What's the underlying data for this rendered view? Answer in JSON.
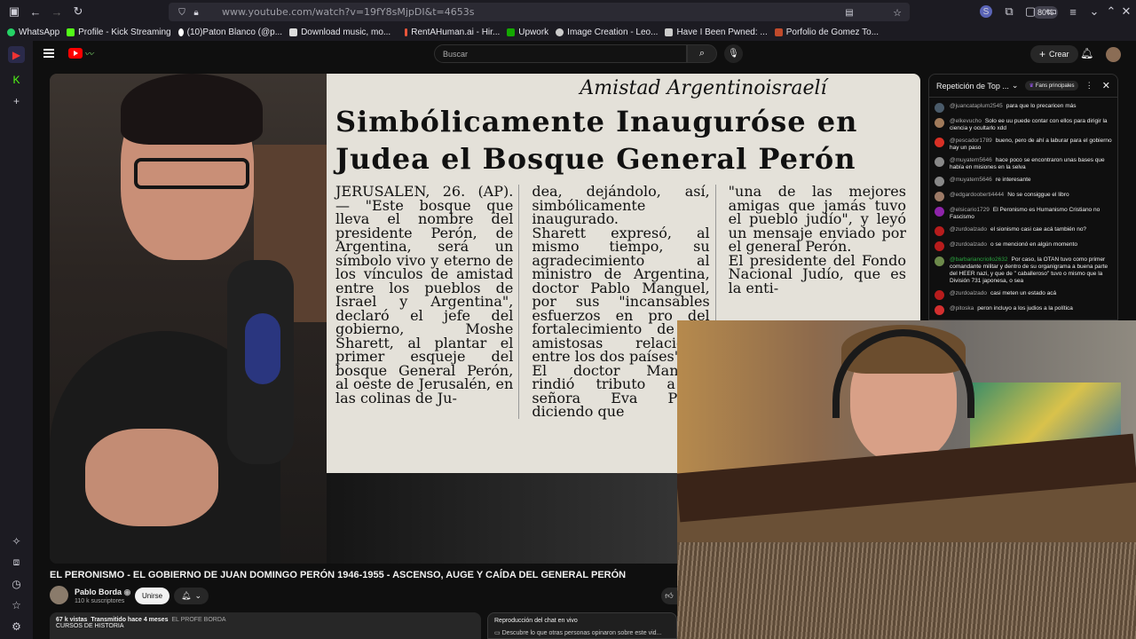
{
  "browser": {
    "url": "www.youtube.com/watch?v=19fY8sMjpDI&t=4653s",
    "zoom": "80%"
  },
  "bookmarks": [
    {
      "label": "WhatsApp",
      "color": "#25d366"
    },
    {
      "label": "Profile - Kick Streaming",
      "color": "#53fc18"
    },
    {
      "label": "(10)Paton Blanco (@p...",
      "color": "#ffffff"
    },
    {
      "label": "Download music, mo...",
      "color": "#dddddd"
    },
    {
      "label": "RentAHuman.ai - Hir...",
      "color": "#e8553a"
    },
    {
      "label": "Upwork",
      "color": "#14a800"
    },
    {
      "label": "Image Creation - Leo...",
      "color": "#cccccc"
    },
    {
      "label": "Have I Been Pwned: ...",
      "color": "#cccccc"
    },
    {
      "label": "Porfolio de Gomez To...",
      "color": "#c04a2b"
    }
  ],
  "header": {
    "search_placeholder": "Buscar",
    "create_label": "Crear"
  },
  "newspaper": {
    "kicker": "Amistad Argentinoisraelí",
    "headline": "Simbólicamente Inauguróse en Judea el Bosque General Perón",
    "col1": "JERUSALEN, 26. (AP). — \"Este bosque que lleva el nombre del presidente Perón, de Argentina, será un símbolo vivo y eterno de los vínculos de amistad entre los pueblos de Israel y Argentina\", declaró el jefe del gobierno, Moshe Sharett, al plantar el primer esqueje del bosque General Perón, al oeste de Jerusalén, en las colinas de Ju-",
    "col2": "dea, dejándolo, así, simbólicamente inaugurado.\nSharett expresó, al mismo tiempo, su agradecimiento al ministro de Argentina, doctor Pablo Manguel, por sus \"incansables esfuerzos en pro del fortalecimiento de las amistosas relaciones entre los dos países\".\nEl doctor Manguel rindió tributo a la señora Eva Perón diciendo que",
    "col3": "\"una de las mejores amigas que jamás tuvo el pueblo judío\", y leyó un mensaje enviado por el general Perón.\nEl presidente del Fondo Nacional Judío, que es la enti-"
  },
  "video": {
    "title": "EL PERONISMO - EL GOBIERNO DE JUAN DOMINGO PERÓN 1946-1955 - ASCENSO, AUGE Y CAÍDA DEL GENERAL PERÓN",
    "channel": "Pablo Borda",
    "subscribers": "110 k suscriptores",
    "join_label": "Unirse",
    "views": "67 k vistas",
    "streamed": "Transmitido hace 4 meses",
    "uploader_tag": "EL PROFE BORDA",
    "category": "CURSOS DE HISTORIA",
    "chat_replay_label": "Reproducción del chat en vivo",
    "chat_replay_sub": "Descubre lo que otras personas opinaron sobre este vid..."
  },
  "chat": {
    "title": "Repetición de Top ...",
    "fans_label": "Fans principales",
    "messages": [
      {
        "author": "@juancataplum2545",
        "text": "para que lo precaricen más",
        "color": "#4a5b6a",
        "member": false
      },
      {
        "author": "@elkevucho",
        "text": "Solo ee uu puede contar con ellos para dirigir la ciencia y ocultarlo xdd",
        "color": "#a07a5a",
        "member": false
      },
      {
        "author": "@pescador1789",
        "text": "bueno, pero de ahí a laburar para el gobierno hay un paso",
        "color": "#d93025",
        "member": false
      },
      {
        "author": "@muyatem5646",
        "text": "hace poco se encontraron unas bases que había en misiones en la selva",
        "color": "#888888",
        "member": false
      },
      {
        "author": "@muyatem5646",
        "text": "re interesante",
        "color": "#888888",
        "member": false
      },
      {
        "author": "@edgardooberti4444",
        "text": "No se consiggue el libro",
        "color": "#9c7a66",
        "member": false
      },
      {
        "author": "@elsicario1729",
        "text": "El Peronismo es Humanismo Cristiano no Fascismo",
        "color": "#8e24aa",
        "member": false
      },
      {
        "author": "@zurdoalzado",
        "text": "el sionismo casi cae acá también no?",
        "color": "#b71c1c",
        "member": false
      },
      {
        "author": "@zurdoalzado",
        "text": "o se mencionó en algún momento",
        "color": "#b71c1c",
        "member": false
      },
      {
        "author": "@barbariancriollo2632",
        "text": "Por caso, la OTAN tuvo como primer comandante militar y dentro de su organigrama a buena parte del HEER nazi, y que de \" caballeroso\" tuvo o mismo que la División 731 japonesa, o sea",
        "color": "#6d8a4b",
        "member": true
      },
      {
        "author": "@zurdoalzado",
        "text": "casi meten un estado acá",
        "color": "#b71c1c",
        "member": false
      },
      {
        "author": "@pitoska",
        "text": "peron incluyo a los judios a la política",
        "color": "#d32f2f",
        "member": false
      }
    ]
  }
}
